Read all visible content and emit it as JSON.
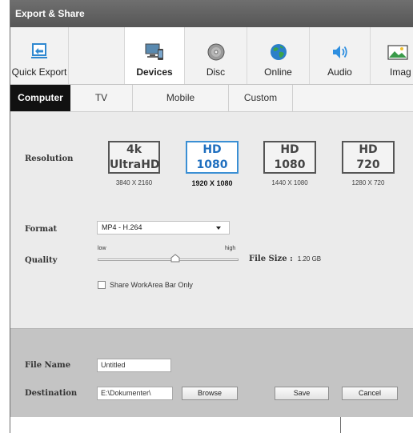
{
  "dialog": {
    "title": "Export & Share"
  },
  "toolbar": {
    "items": [
      {
        "label": "Quick Export",
        "icon": "quick-export-icon"
      },
      {
        "label": "Devices",
        "icon": "devices-icon",
        "active": true
      },
      {
        "label": "Disc",
        "icon": "disc-icon"
      },
      {
        "label": "Online",
        "icon": "globe-icon"
      },
      {
        "label": "Audio",
        "icon": "speaker-icon"
      },
      {
        "label": "Imag",
        "icon": "image-icon"
      }
    ]
  },
  "tabs": [
    {
      "label": "Computer",
      "active": true
    },
    {
      "label": "TV"
    },
    {
      "label": "Mobile"
    },
    {
      "label": "Custom"
    }
  ],
  "resolution": {
    "label": "Resolution",
    "options": [
      {
        "line1": "4k",
        "line2": "UltraHD",
        "dims": "3840 X 2160"
      },
      {
        "line1": "HD",
        "line2": "1080",
        "dims": "1920 X 1080",
        "active": true
      },
      {
        "line1": "HD",
        "line2": "1080",
        "dims": "1440 X 1080"
      },
      {
        "line1": "HD",
        "line2": "720",
        "dims": "1280 X 720"
      }
    ]
  },
  "format": {
    "label": "Format",
    "value": "MP4 - H.264"
  },
  "quality": {
    "label": "Quality",
    "low": "low",
    "high": "high",
    "level": 0.55
  },
  "filesize": {
    "label": "File Size :",
    "value": "1.20 GB"
  },
  "share": {
    "label": "Share WorkArea Bar Only",
    "checked": false
  },
  "filename": {
    "label": "File Name",
    "value": "Untitled"
  },
  "destination": {
    "label": "Destination",
    "value": "E:\\Dokumenter\\"
  },
  "buttons": {
    "browse": "Browse",
    "save": "Save",
    "cancel": "Cancel"
  },
  "colors": {
    "accent": "#3a8fd4",
    "title_bar": "#5f5f5f",
    "active_tab": "#111111"
  }
}
